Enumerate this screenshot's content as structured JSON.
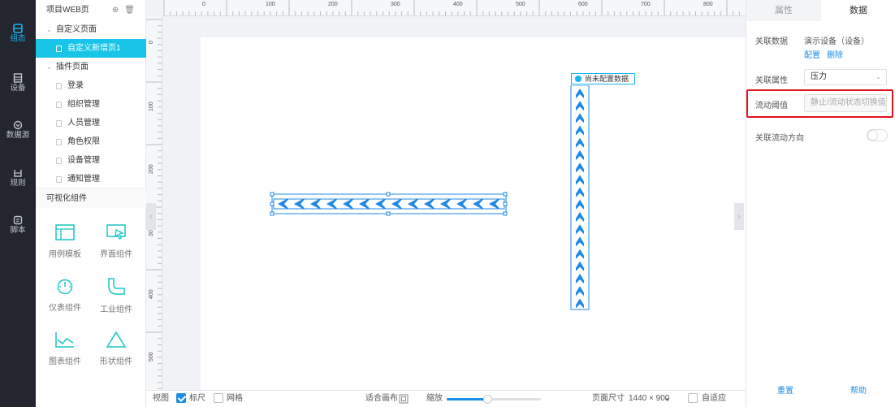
{
  "nav": {
    "items": [
      {
        "label": "组态",
        "icon": "layers-icon",
        "active": true
      },
      {
        "label": "设备",
        "icon": "device-icon",
        "active": false
      },
      {
        "label": "数据源",
        "icon": "datasource-icon",
        "active": false
      },
      {
        "label": "规则",
        "icon": "rule-icon",
        "active": false
      },
      {
        "label": "脚本",
        "icon": "script-icon",
        "active": false
      }
    ]
  },
  "tree": {
    "title": "项目WEB页",
    "groups": [
      {
        "label": "自定义页面",
        "items": [
          {
            "label": "自定义新增页1",
            "selected": true
          }
        ]
      },
      {
        "label": "插件页面",
        "items": [
          {
            "label": "登录"
          },
          {
            "label": "组织管理"
          },
          {
            "label": "人员管理"
          },
          {
            "label": "角色权限"
          },
          {
            "label": "设备管理"
          },
          {
            "label": "通知管理"
          }
        ]
      }
    ],
    "components_title": "可视化组件",
    "components": [
      {
        "label": "用例模板",
        "icon": "template-icon"
      },
      {
        "label": "界面组件",
        "icon": "ui-component-icon"
      },
      {
        "label": "仪表组件",
        "icon": "gauge-icon"
      },
      {
        "label": "工业组件",
        "icon": "pipe-icon"
      },
      {
        "label": "图表组件",
        "icon": "line-chart-icon"
      },
      {
        "label": "形状组件",
        "icon": "triangle-icon"
      }
    ]
  },
  "rulers": {
    "top": [
      "0",
      "100",
      "200",
      "300",
      "400",
      "500",
      "600",
      "700",
      "800"
    ],
    "left": [
      "0",
      "100",
      "200",
      "300",
      "400",
      "500"
    ]
  },
  "canvas": {
    "pipe_label": "尚未配置数据"
  },
  "bottom": {
    "view_label": "视图",
    "ruler_label": "标尺",
    "ruler_checked": true,
    "grid_label": "网格",
    "grid_checked": false,
    "fit_label": "适合画布",
    "zoom_label": "缩放",
    "zoom_level": 0.43,
    "page_size_label": "页面尺寸",
    "page_size_value": "1440 × 900",
    "auto_fit_label": "自适应"
  },
  "props": {
    "tabs": [
      {
        "label": "属性",
        "active": false
      },
      {
        "label": "数据",
        "active": true
      }
    ],
    "linked_data_label": "关联数据",
    "linked_data_value": "演示设备（设备）",
    "config_link": "配置",
    "delete_link": "删除",
    "linked_attr_label": "关联属性",
    "linked_attr_value": "压力",
    "flow_threshold_label": "流动阈值",
    "flow_threshold_placeholder": "静止/流动状态切换值",
    "flow_direction_label": "关联流动方向",
    "flow_direction_on": false,
    "reset_label": "重置",
    "help_label": "帮助"
  },
  "colors": {
    "accent": "#18b4f0",
    "pipe": "#1e88e5",
    "highlight": "#e0141e"
  }
}
